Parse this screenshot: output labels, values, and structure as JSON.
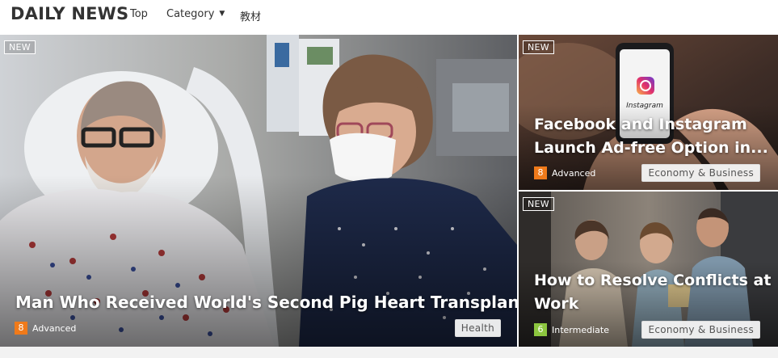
{
  "header": {
    "logo": "DAILY NEWS",
    "nav": {
      "top": "Top",
      "category": "Category",
      "kyozai": "教材"
    }
  },
  "articles": [
    {
      "badge": "NEW",
      "title": "Man Who Received World's Second Pig Heart Transplant Dies",
      "level_number": "8",
      "level_label": "Advanced",
      "level_color": "#f07a1a",
      "category": "Health"
    },
    {
      "badge": "NEW",
      "title": "Facebook and Instagram Launch Ad-free Option in...",
      "level_number": "8",
      "level_label": "Advanced",
      "level_color": "#f07a1a",
      "category": "Economy & Business"
    },
    {
      "badge": "NEW",
      "title": "How to Resolve Conflicts at Work",
      "level_number": "6",
      "level_label": "Intermediate",
      "level_color": "#8cc63f",
      "category": "Economy & Business"
    }
  ],
  "colors": {
    "level_advanced": "#f07a1a",
    "level_intermediate": "#8cc63f"
  }
}
